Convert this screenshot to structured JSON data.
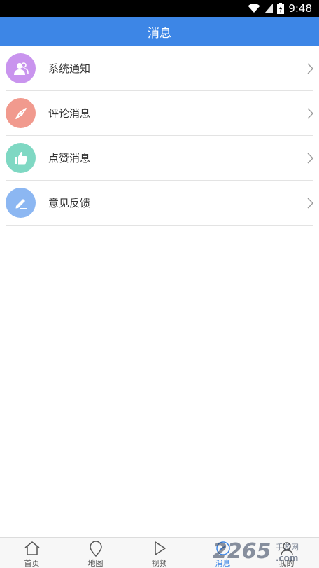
{
  "status_bar": {
    "time": "9:48"
  },
  "header": {
    "title": "消息"
  },
  "colors": {
    "header_bg": "#3d86e6",
    "icon_system": "#c994ee",
    "icon_comment": "#f19a8e",
    "icon_like": "#7fd8c3",
    "icon_feedback": "#8cb7f2",
    "tab_active": "#3d86e6"
  },
  "list": {
    "items": [
      {
        "label": "系统通知",
        "icon": "users-icon"
      },
      {
        "label": "评论消息",
        "icon": "compass-icon"
      },
      {
        "label": "点赞消息",
        "icon": "thumbs-up-icon"
      },
      {
        "label": "意见反馈",
        "icon": "pencil-icon"
      }
    ]
  },
  "tabbar": {
    "tabs": [
      {
        "label": "首页",
        "icon": "home-icon"
      },
      {
        "label": "地图",
        "icon": "map-pin-icon"
      },
      {
        "label": "视频",
        "icon": "play-icon"
      },
      {
        "label": "消息",
        "icon": "message-icon",
        "active": true
      },
      {
        "label": "我的",
        "icon": "user-icon"
      }
    ]
  },
  "watermark": {
    "brand": "2265",
    "sub": "手游网",
    "domain": ".com"
  }
}
